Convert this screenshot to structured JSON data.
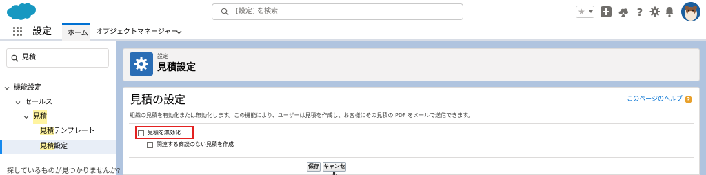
{
  "header": {
    "search_placeholder": "[設定] を検索"
  },
  "context_bar": {
    "app_name": "設定",
    "tabs": [
      {
        "label": "ホーム"
      },
      {
        "label": "オブジェクトマネージャー"
      }
    ]
  },
  "sidebar": {
    "quick_find_value": "見積",
    "tree": {
      "level1": "機能設定",
      "level2": "セールス",
      "level3_highlight": "見積",
      "children": [
        {
          "highlight": "見積",
          "rest": "テンプレート"
        },
        {
          "highlight": "見積",
          "rest": "設定"
        }
      ]
    },
    "help_text": "探しているものが見つかりませんか?"
  },
  "page_header": {
    "breadcrumb": "設定",
    "title": "見積設定"
  },
  "content": {
    "title": "見積の設定",
    "help_link": "このページのヘルプ",
    "help_icon_text": "?",
    "description": "組織の見積を有効化または無効化します。この機能により、ユーザーは見積を作成し、お客様にその見積の PDF をメールで送信できます。",
    "options": [
      {
        "label": "見積を無効化",
        "checked": false
      },
      {
        "label": "関連する商談のない見積を作成",
        "checked": false
      }
    ],
    "buttons": {
      "save": "保存",
      "cancel": "キャンセル"
    }
  },
  "colors": {
    "brand_blue": "#0070d2",
    "cloud_blue": "#1798c1",
    "setup_icon_bg": "#2a6db5",
    "highlight": "#fff4a0",
    "red_outline": "#e32120"
  }
}
